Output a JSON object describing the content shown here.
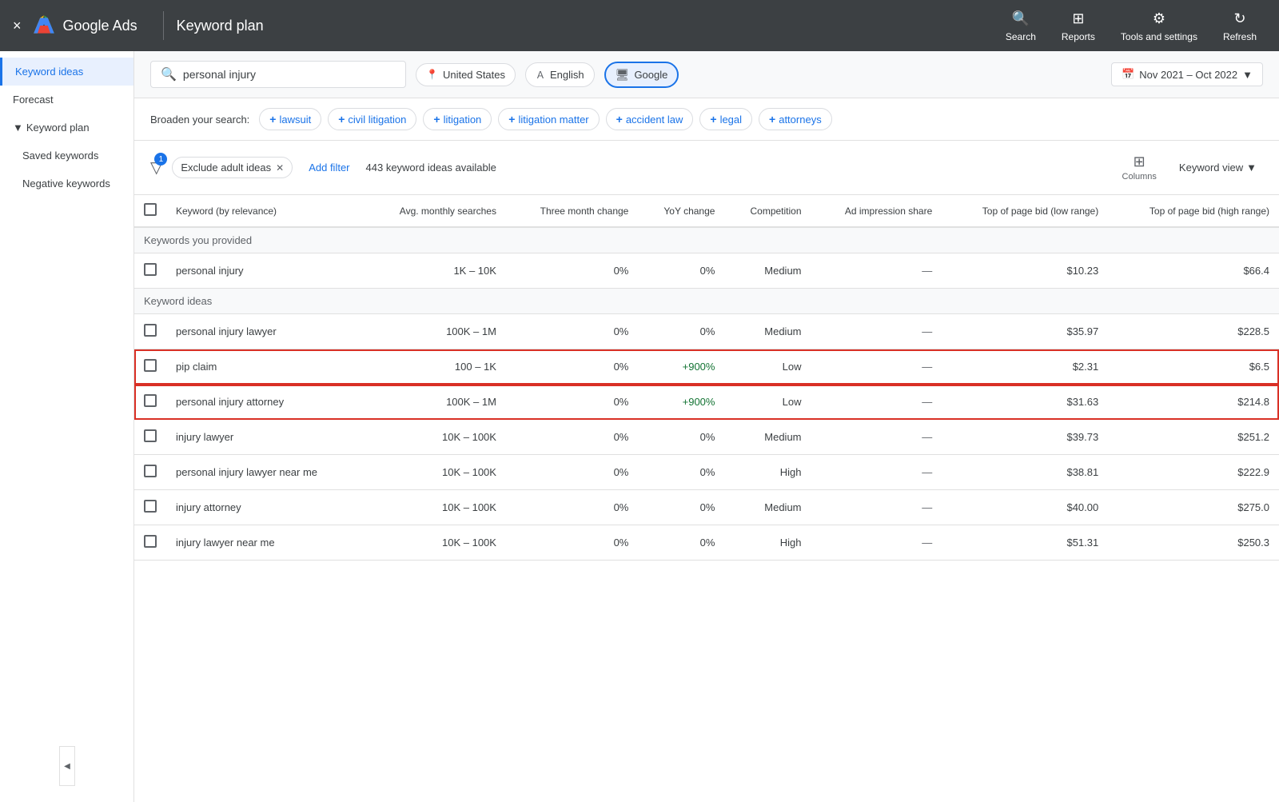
{
  "topBar": {
    "appName": "Google Ads",
    "pageTitle": "Keyword plan",
    "closeLabel": "×",
    "actions": [
      {
        "id": "search",
        "label": "Search",
        "icon": "🔍"
      },
      {
        "id": "reports",
        "label": "Reports",
        "icon": "⊞"
      },
      {
        "id": "tools",
        "label": "Tools and settings",
        "icon": "⚙"
      },
      {
        "id": "refresh",
        "label": "Refresh",
        "icon": "↻"
      }
    ]
  },
  "sidebar": {
    "items": [
      {
        "id": "keyword-ideas",
        "label": "Keyword ideas",
        "active": true
      },
      {
        "id": "forecast",
        "label": "Forecast",
        "active": false
      },
      {
        "id": "keyword-plan",
        "label": "Keyword plan",
        "active": false,
        "isSection": true,
        "expanded": true
      },
      {
        "id": "saved-keywords",
        "label": "Saved keywords",
        "active": false
      },
      {
        "id": "negative-keywords",
        "label": "Negative keywords",
        "active": false
      }
    ]
  },
  "filters": {
    "searchValue": "personal injury",
    "searchPlaceholder": "personal injury",
    "location": "United States",
    "language": "English",
    "network": "Google",
    "dateRange": "Nov 2021 – Oct 2022"
  },
  "broadenSearch": {
    "label": "Broaden your search:",
    "chips": [
      "lawsuit",
      "civil litigation",
      "litigation",
      "litigation matter",
      "accident law",
      "legal",
      "attorneys"
    ]
  },
  "toolbar": {
    "filterBadge": "1",
    "excludeChipLabel": "Exclude adult ideas",
    "addFilterLabel": "Add filter",
    "keywordCount": "443 keyword ideas available",
    "columnsLabel": "Columns",
    "viewLabel": "Keyword view"
  },
  "table": {
    "headers": [
      {
        "id": "checkbox",
        "label": ""
      },
      {
        "id": "keyword",
        "label": "Keyword (by relevance)"
      },
      {
        "id": "avg-monthly",
        "label": "Avg. monthly searches"
      },
      {
        "id": "three-month",
        "label": "Three month change"
      },
      {
        "id": "yoy",
        "label": "YoY change"
      },
      {
        "id": "competition",
        "label": "Competition"
      },
      {
        "id": "ad-impression",
        "label": "Ad impression share"
      },
      {
        "id": "top-page-low",
        "label": "Top of page bid (low range)"
      },
      {
        "id": "top-page-high",
        "label": "Top of page bid (high range)"
      }
    ],
    "sections": [
      {
        "id": "provided",
        "label": "Keywords you provided",
        "rows": [
          {
            "keyword": "personal injury",
            "avgMonthly": "1K – 10K",
            "threeMonth": "0%",
            "yoy": "0%",
            "competition": "Medium",
            "adImpression": "—",
            "topPageLow": "$10.23",
            "topPageHigh": "$66.4",
            "highlighted": false
          }
        ]
      },
      {
        "id": "ideas",
        "label": "Keyword ideas",
        "rows": [
          {
            "keyword": "personal injury lawyer",
            "avgMonthly": "100K – 1M",
            "threeMonth": "0%",
            "yoy": "0%",
            "competition": "Medium",
            "adImpression": "—",
            "topPageLow": "$35.97",
            "topPageHigh": "$228.5",
            "highlighted": false
          },
          {
            "keyword": "pip claim",
            "avgMonthly": "100 – 1K",
            "threeMonth": "0%",
            "yoy": "+900%",
            "competition": "Low",
            "adImpression": "—",
            "topPageLow": "$2.31",
            "topPageHigh": "$6.5",
            "highlighted": true
          },
          {
            "keyword": "personal injury attorney",
            "avgMonthly": "100K – 1M",
            "threeMonth": "0%",
            "yoy": "+900%",
            "competition": "Low",
            "adImpression": "—",
            "topPageLow": "$31.63",
            "topPageHigh": "$214.8",
            "highlighted": true
          },
          {
            "keyword": "injury lawyer",
            "avgMonthly": "10K – 100K",
            "threeMonth": "0%",
            "yoy": "0%",
            "competition": "Medium",
            "adImpression": "—",
            "topPageLow": "$39.73",
            "topPageHigh": "$251.2",
            "highlighted": false
          },
          {
            "keyword": "personal injury lawyer near me",
            "avgMonthly": "10K – 100K",
            "threeMonth": "0%",
            "yoy": "0%",
            "competition": "High",
            "adImpression": "—",
            "topPageLow": "$38.81",
            "topPageHigh": "$222.9",
            "highlighted": false
          },
          {
            "keyword": "injury attorney",
            "avgMonthly": "10K – 100K",
            "threeMonth": "0%",
            "yoy": "0%",
            "competition": "Medium",
            "adImpression": "—",
            "topPageLow": "$40.00",
            "topPageHigh": "$275.0",
            "highlighted": false
          },
          {
            "keyword": "injury lawyer near me",
            "avgMonthly": "10K – 100K",
            "threeMonth": "0%",
            "yoy": "0%",
            "competition": "High",
            "adImpression": "—",
            "topPageLow": "$51.31",
            "topPageHigh": "$250.3",
            "highlighted": false
          }
        ]
      }
    ]
  }
}
